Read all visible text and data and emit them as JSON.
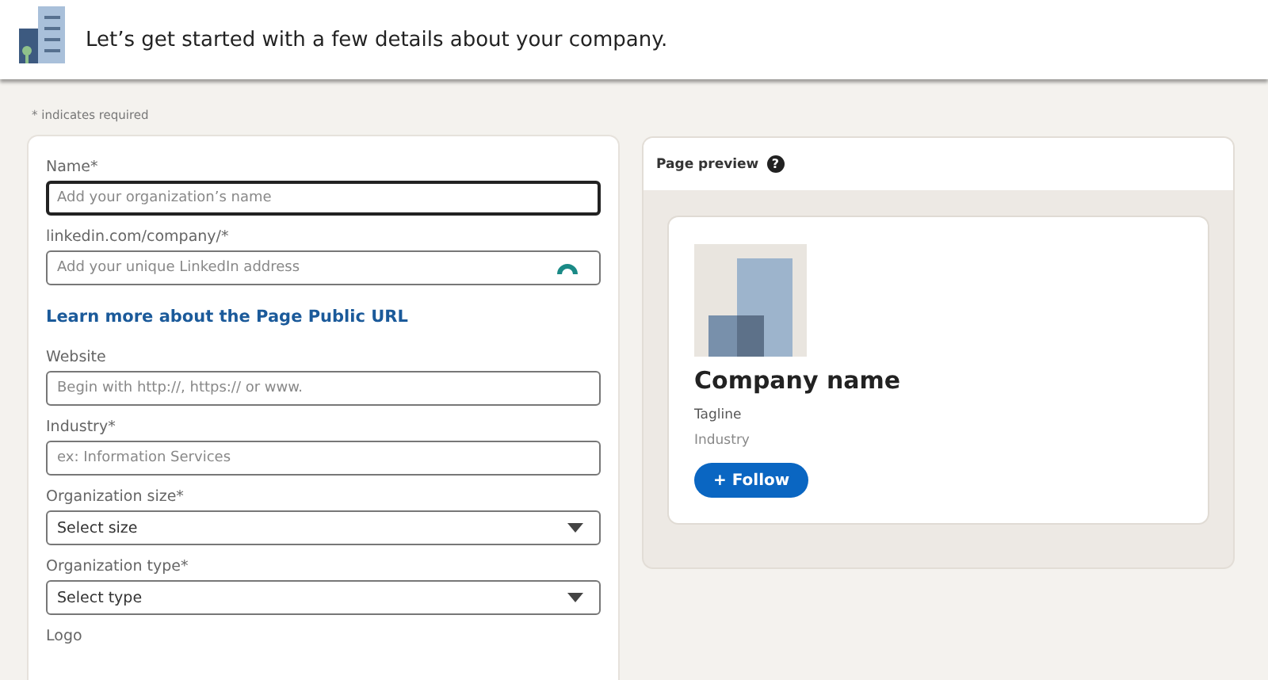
{
  "header": {
    "title": "Let’s get started with a few details about your company."
  },
  "required_note": "* indicates required",
  "form": {
    "items": [
      {
        "kind": "text",
        "label": "Name*",
        "placeholder": "Add your organization’s name",
        "focused": true
      },
      {
        "kind": "text-loading",
        "label": "linkedin.com/company/*",
        "placeholder": "Add your unique LinkedIn address",
        "focused": false
      },
      {
        "kind": "link",
        "text": "Learn more about the Page Public URL"
      },
      {
        "kind": "text",
        "label": "Website",
        "placeholder": "Begin with http://, https:// or www.",
        "focused": false
      },
      {
        "kind": "text",
        "label": "Industry*",
        "placeholder": "ex: Information Services",
        "focused": false
      },
      {
        "kind": "select",
        "label": "Organization size*",
        "value": "Select size"
      },
      {
        "kind": "select",
        "label": "Organization type*",
        "value": "Select type"
      },
      {
        "kind": "label",
        "label": "Logo"
      }
    ]
  },
  "preview": {
    "title": "Page preview",
    "help_icon": "?",
    "company_name": "Company name",
    "tagline": "Tagline",
    "industry": "Industry",
    "follow_button": "+ Follow"
  }
}
